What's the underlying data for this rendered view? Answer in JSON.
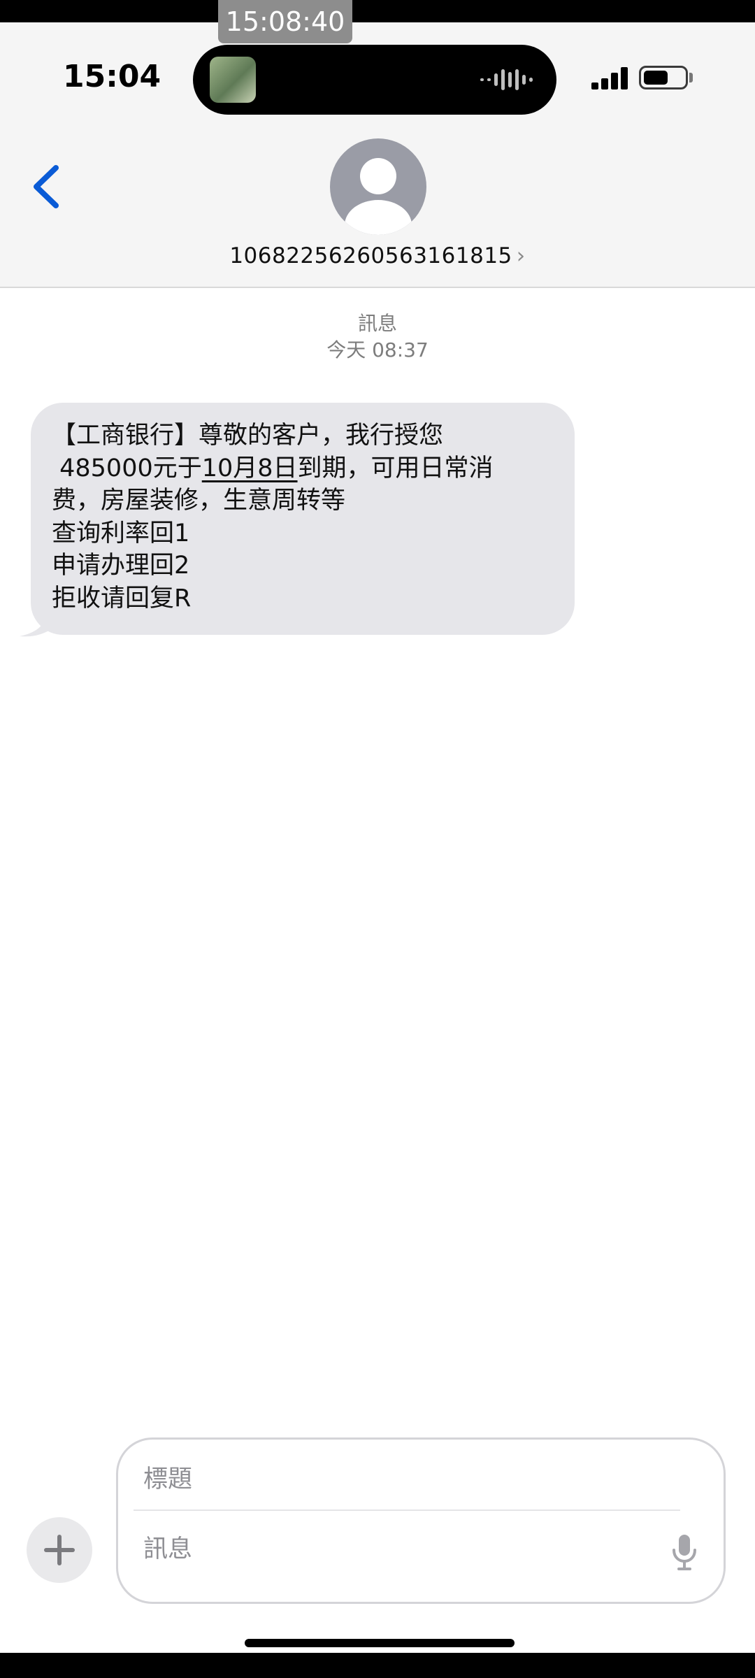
{
  "recording_timestamp": "15:08:40",
  "status_bar": {
    "time": "15:04",
    "icons": [
      "cellular-signal-icon",
      "battery-icon"
    ]
  },
  "dynamic_island": {
    "activity": "audio-recording"
  },
  "header": {
    "back_icon": "chevron-left-icon",
    "avatar_icon": "person-icon",
    "contact_number": "1068225626056316181​5",
    "contact_chevron": "›"
  },
  "thread": {
    "service_label": "訊息",
    "timestamp": "今天 08:37"
  },
  "message": {
    "lines": [
      "【工商银行】尊敬的客户，我行授您",
      " 485000元于",
      "10月8日",
      "到期，可用日常消",
      "费，房屋装修，生意周转等",
      "查询利率回1",
      "申请办理回2",
      "拒收请回复R"
    ]
  },
  "composer": {
    "subject_placeholder": "標題",
    "message_placeholder": "訊息",
    "plus_icon": "plus-icon",
    "mic_icon": "microphone-icon"
  },
  "colors": {
    "accent": "#0a5bd6",
    "bubble": "#e6e6ea",
    "header_bg": "#f5f5f5",
    "secondary_text": "#7d7d7d"
  }
}
